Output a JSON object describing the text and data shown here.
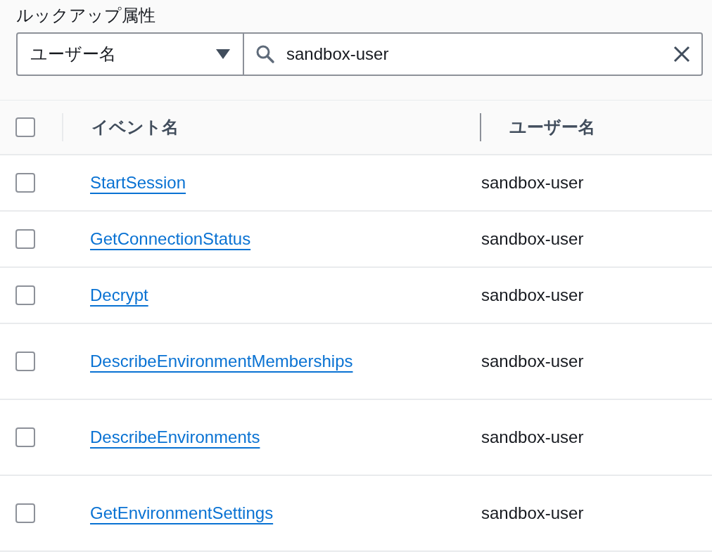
{
  "filter": {
    "title": "ルックアップ属性",
    "attribute": "ユーザー名",
    "search_value": "sandbox-user"
  },
  "table": {
    "columns": [
      "イベント名",
      "ユーザー名"
    ],
    "select_all_checked": false,
    "rows": [
      {
        "event": "StartSession",
        "user": "sandbox-user",
        "checked": false
      },
      {
        "event": "GetConnectionStatus",
        "user": "sandbox-user",
        "checked": false
      },
      {
        "event": "Decrypt",
        "user": "sandbox-user",
        "checked": false
      },
      {
        "event": "DescribeEnvironmentMemberships",
        "user": "sandbox-user",
        "checked": false
      },
      {
        "event": "DescribeEnvironments",
        "user": "sandbox-user",
        "checked": false
      },
      {
        "event": "GetEnvironmentSettings",
        "user": "sandbox-user",
        "checked": false
      }
    ]
  }
}
